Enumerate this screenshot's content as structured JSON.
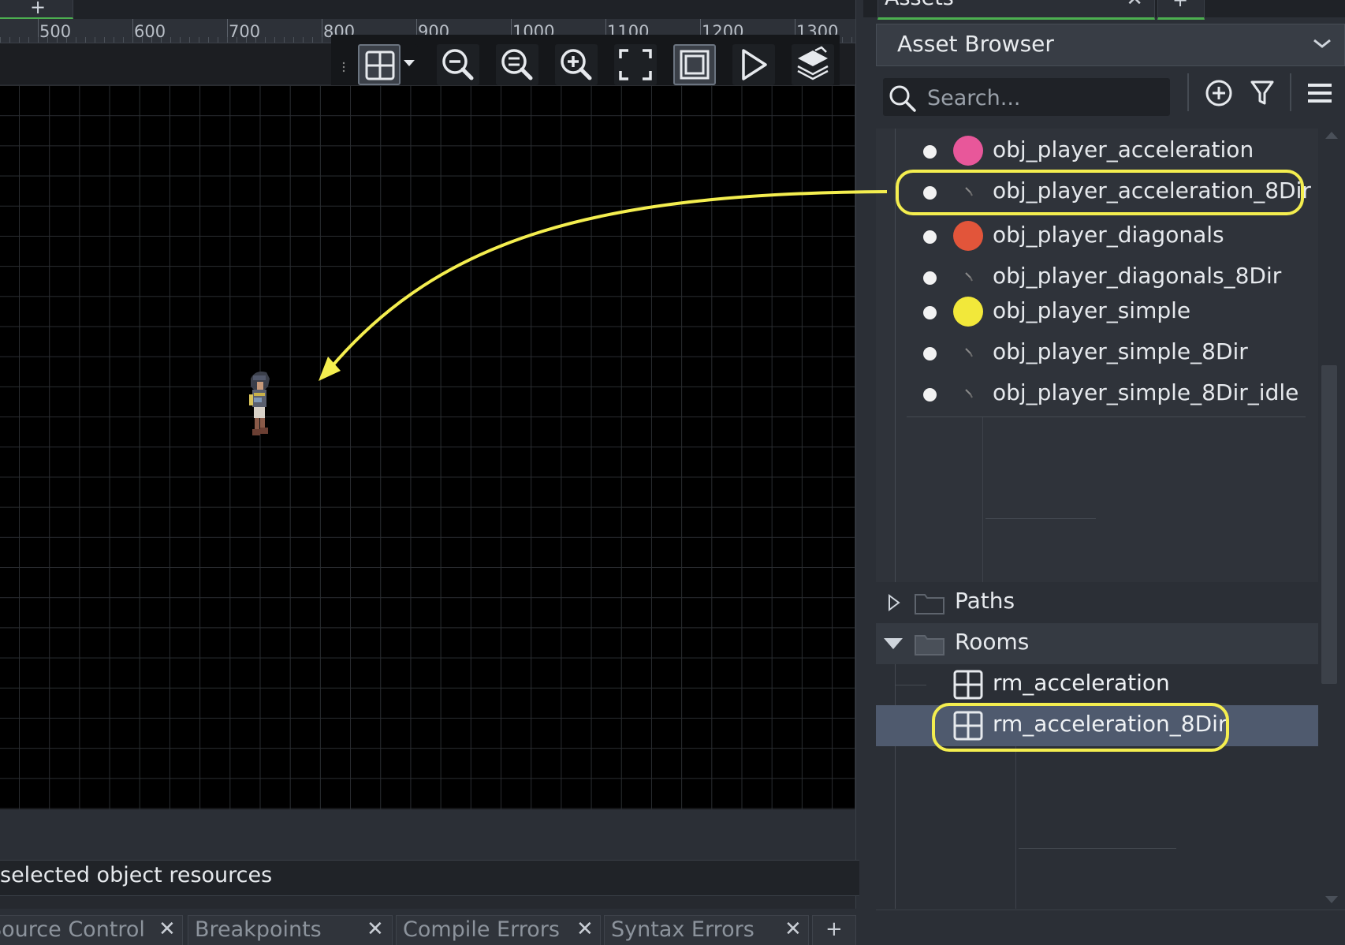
{
  "editor": {
    "top_tab_label": "+",
    "ruler_ticks": [
      "500",
      "600",
      "700",
      "800",
      "900",
      "1000",
      "1100",
      "1200",
      "1300"
    ],
    "status_text": "selected object resources",
    "bottom_tabs": [
      {
        "label": "Source Control",
        "close": "✕"
      },
      {
        "label": "Breakpoints",
        "close": "✕"
      },
      {
        "label": "Compile Errors",
        "close": "✕"
      },
      {
        "label": "Syntax Errors",
        "close": "✕"
      }
    ],
    "bottom_add_tab": "+"
  },
  "toolbar": {
    "icons": [
      "grid-toggle-icon",
      "grid-dropdown-icon",
      "zoom-out-icon",
      "zoom-reset-icon",
      "zoom-in-icon",
      "fullscreen-icon",
      "room-bounds-icon",
      "play-icon",
      "layers-icon"
    ]
  },
  "panel": {
    "tab_label": "Assets",
    "tab_close": "✕",
    "add_tab": "+",
    "browser_title": "Asset Browser",
    "search_placeholder": "Search...",
    "header_icons": [
      "create-asset-icon",
      "filter-icon",
      "menu-icon"
    ]
  },
  "objects": [
    {
      "name": "obj_player_acceleration",
      "icon": "pink-ball",
      "color": "#e8579a"
    },
    {
      "name": "obj_player_acceleration_8Dir",
      "icon": "tiny-sprite",
      "color": "#6b6b6b"
    },
    {
      "name": "obj_player_diagonals",
      "icon": "red-ball",
      "color": "#e2553a"
    },
    {
      "name": "obj_player_diagonals_8Dir",
      "icon": "tiny-sprite",
      "color": "#6b6b6b"
    },
    {
      "name": "obj_player_simple",
      "icon": "yellow-ball",
      "color": "#f2e83a"
    },
    {
      "name": "obj_player_simple_8Dir",
      "icon": "tiny-sprite",
      "color": "#6b6b6b"
    },
    {
      "name": "obj_player_simple_8Dir_idle",
      "icon": "tiny-sprite",
      "color": "#6b6b6b"
    }
  ],
  "folders": {
    "paths": "Paths",
    "rooms": "Rooms"
  },
  "rooms": [
    {
      "name": "rm_acceleration"
    },
    {
      "name": "rm_acceleration_8Dir",
      "selected": true
    }
  ],
  "colors": {
    "highlight": "#f4ee4f",
    "tab_accent": "#4caf50",
    "selection": "#4f5a6e"
  }
}
